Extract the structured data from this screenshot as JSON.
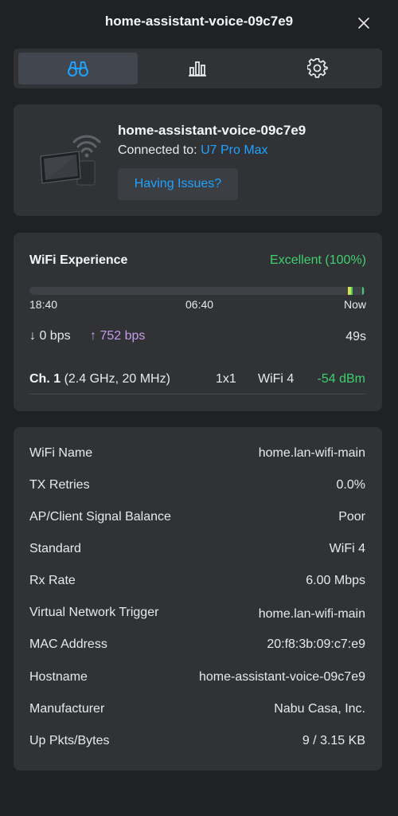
{
  "header": {
    "title": "home-assistant-voice-09c7e9"
  },
  "tabs": [
    {
      "id": "overview",
      "icon": "binoculars-icon",
      "active": true
    },
    {
      "id": "stats",
      "icon": "bar-chart-icon",
      "active": false
    },
    {
      "id": "settings",
      "icon": "gear-icon",
      "active": false
    }
  ],
  "device": {
    "name": "home-assistant-voice-09c7e9",
    "connected_label": "Connected to:",
    "ap_name": "U7 Pro Max",
    "issues_button": "Having Issues?",
    "image_icon": "wireless-device-icon"
  },
  "wifi": {
    "experience_label": "WiFi Experience",
    "experience_value": "Excellent (100%)",
    "timeline_ticks": [
      "18:40",
      "06:40",
      "Now"
    ],
    "down_rate": "0 bps",
    "up_rate": "752 bps",
    "duration": "49s",
    "channel": "Ch. 1",
    "channel_detail": "(2.4 GHz, 20 MHz)",
    "mimo": "1x1",
    "standard": "WiFi 4",
    "signal": "-54 dBm",
    "colors": {
      "good": "#3ed06e",
      "upload": "#c79be8",
      "link": "#1fa3ff"
    }
  },
  "details": [
    {
      "key": "WiFi Name",
      "value": "home.lan-wifi-main"
    },
    {
      "key": "TX Retries",
      "value": "0.0%"
    },
    {
      "key": "AP/Client Signal Balance",
      "value": "Poor"
    },
    {
      "key": "Standard",
      "value": "WiFi 4"
    },
    {
      "key": "Rx Rate",
      "value": "6.00 Mbps"
    },
    {
      "key": "Virtual Network Trigger",
      "value": "home.lan-wifi-main"
    },
    {
      "key": "MAC Address",
      "value": "20:f8:3b:09:c7:e9"
    },
    {
      "key": "Hostname",
      "value": "home-assistant-voice-09c7e9"
    },
    {
      "key": "Manufacturer",
      "value": "Nabu Casa, Inc."
    },
    {
      "key": "Up Pkts/Bytes",
      "value": "9 / 3.15 KB"
    }
  ]
}
